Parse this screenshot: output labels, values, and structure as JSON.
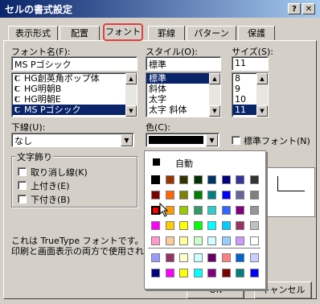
{
  "window": {
    "title": "セルの書式設定",
    "help_button": "?",
    "close_button": "✕"
  },
  "tabs": [
    {
      "label": "表示形式"
    },
    {
      "label": "配置"
    },
    {
      "label": "フォント"
    },
    {
      "label": "罫線"
    },
    {
      "label": "パターン"
    },
    {
      "label": "保護"
    }
  ],
  "font_name": {
    "label": "フォント名(F):",
    "value": "MS Pゴシック",
    "items": [
      "HG創英角ポップ体",
      "HG明朝B",
      "HG明朝E",
      "MS Pゴシック"
    ]
  },
  "style": {
    "label": "スタイル(O):",
    "value": "標準",
    "items": [
      "標準",
      "斜体",
      "太字",
      "太字 斜体"
    ]
  },
  "size": {
    "label": "サイズ(S):",
    "value": "11",
    "items": [
      "8",
      "9",
      "10",
      "11"
    ]
  },
  "underline": {
    "label": "下線(U):",
    "value": "なし"
  },
  "color": {
    "label": "色(C):",
    "value": "#000000"
  },
  "normal_font": {
    "label": "標準フォント(N)",
    "checked": false
  },
  "effects": {
    "label": "文字飾り",
    "strikethrough": "取り消し線(K)",
    "superscript": "上付き(E)",
    "subscript": "下付き(B)"
  },
  "info": {
    "line1": "これは TrueType フォントです。",
    "line2": "印刷と画面表示の両方で使用され"
  },
  "buttons": {
    "ok": "OK",
    "cancel": "キャンセル"
  },
  "palette": {
    "auto_label": "自動",
    "selected_color": "#ff0000",
    "rows": [
      [
        "#000000",
        "#993300",
        "#333300",
        "#003300",
        "#003366",
        "#000080",
        "#333399",
        "#333333"
      ],
      [
        "#800000",
        "#ff6600",
        "#808000",
        "#008000",
        "#008080",
        "#0000ff",
        "#666699",
        "#808080"
      ],
      [
        "#ff0000",
        "#ff9900",
        "#99cc00",
        "#339966",
        "#33cccc",
        "#3366ff",
        "#800080",
        "#969696"
      ],
      [
        "#ff00ff",
        "#ffcc00",
        "#ffff00",
        "#00ff00",
        "#00ffff",
        "#00ccff",
        "#993366",
        "#c0c0c0"
      ],
      [
        "#ff99cc",
        "#ffcc99",
        "#ffff99",
        "#ccffcc",
        "#ccffff",
        "#99ccff",
        "#cc99ff",
        "#ffffff"
      ],
      [
        "#9999ff",
        "#993366",
        "#ffffcc",
        "#ccffff",
        "#660066",
        "#ff8080",
        "#0066cc",
        "#ccccff"
      ],
      [
        "#000080",
        "#ff00ff",
        "#ffff00",
        "#00ffff",
        "#800080",
        "#800000",
        "#008080",
        "#0000ff"
      ]
    ]
  }
}
